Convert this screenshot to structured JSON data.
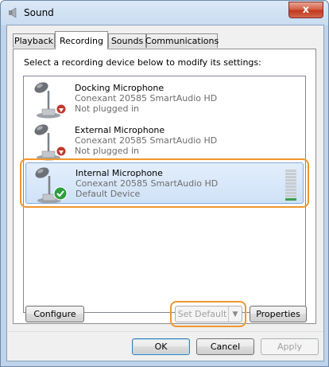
{
  "window": {
    "title": "Sound",
    "close_glyph": "x",
    "icon": "speaker-icon"
  },
  "tabs": [
    {
      "label": "Playback",
      "active": false
    },
    {
      "label": "Recording",
      "active": true
    },
    {
      "label": "Sounds",
      "active": false
    },
    {
      "label": "Communications",
      "active": false
    }
  ],
  "instructions": "Select a recording device below to modify its settings:",
  "devices": [
    {
      "name": "Docking Microphone",
      "driver": "Conexant 20585 SmartAudio HD",
      "status": "Not plugged in",
      "badge": "unplugged",
      "selected": false
    },
    {
      "name": "External Microphone",
      "driver": "Conexant 20585 SmartAudio HD",
      "status": "Not plugged in",
      "badge": "unplugged",
      "selected": false
    },
    {
      "name": "Internal Microphone",
      "driver": "Conexant 20585 SmartAudio HD",
      "status": "Default Device",
      "badge": "default-check",
      "selected": true,
      "level_fraction": 0.1
    }
  ],
  "buttons": {
    "configure": "Configure",
    "set_default": "Set Default",
    "properties": "Properties",
    "ok": "OK",
    "cancel": "Cancel",
    "apply": "Apply"
  },
  "colors": {
    "highlight": "#f0972e",
    "selected_bg": "#cfe2f8",
    "level_on": "#3aa14a"
  }
}
